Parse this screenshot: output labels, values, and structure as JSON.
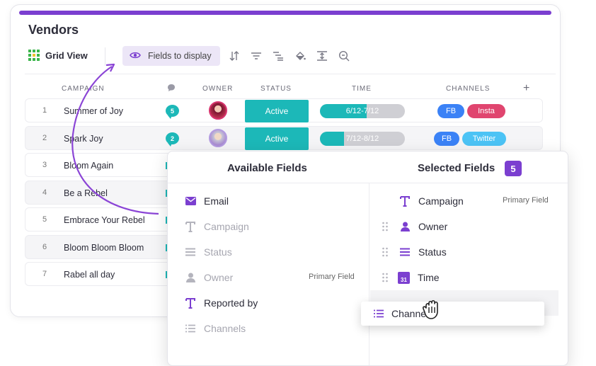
{
  "title": "Vendors",
  "toolbar": {
    "grid_view_label": "Grid View",
    "fields_to_display_label": "Fields to display",
    "icons": [
      "sort-icon",
      "filter-icon",
      "group-icon",
      "color-icon",
      "row-height-icon",
      "search-icon"
    ]
  },
  "table": {
    "headers": {
      "campaign": "CAMPAIGN",
      "owner": "OWNER",
      "status": "STATUS",
      "time": "TIME",
      "channels": "CHANNELS",
      "add": "+"
    },
    "rows": [
      {
        "num": "1",
        "name": "Summer of Joy",
        "comments": "5",
        "status": "Active",
        "time": "6/12-7/12",
        "time_progress": 0.55,
        "channels": [
          "FB",
          "Insta"
        ]
      },
      {
        "num": "2",
        "name": "Spark Joy",
        "comments": "2",
        "status": "Active",
        "time": "7/12-8/12",
        "time_progress": 0.28,
        "channels": [
          "FB",
          "Twitter"
        ]
      },
      {
        "num": "3",
        "name": "Bloom Again"
      },
      {
        "num": "4",
        "name": "Be a Rebel"
      },
      {
        "num": "5",
        "name": "Embrace Your Rebel"
      },
      {
        "num": "6",
        "name": "Bloom Bloom Bloom"
      },
      {
        "num": "7",
        "name": "Rabel all day"
      }
    ]
  },
  "popup": {
    "available_title": "Available Fields",
    "selected_title": "Selected Fields",
    "selected_count": "5",
    "available": [
      {
        "label": "Email",
        "icon": "email-icon",
        "enabled": true
      },
      {
        "label": "Campaign",
        "icon": "text-icon",
        "enabled": false
      },
      {
        "label": "Status",
        "icon": "status-icon",
        "enabled": false
      },
      {
        "label": "Owner",
        "icon": "person-icon",
        "enabled": false,
        "tag": "Primary Field"
      },
      {
        "label": "Reported by",
        "icon": "text-icon",
        "enabled": true
      },
      {
        "label": "Channels",
        "icon": "list-icon",
        "enabled": false
      }
    ],
    "selected": [
      {
        "label": "Campaign",
        "icon": "text-icon",
        "tag": "Primary Field"
      },
      {
        "label": "Owner",
        "icon": "person-icon"
      },
      {
        "label": "Status",
        "icon": "status-icon"
      },
      {
        "label": "Time",
        "icon": "calendar-icon",
        "icon_text": "31"
      }
    ],
    "dragging": {
      "label": "Channels",
      "icon": "list-icon"
    }
  },
  "colors": {
    "accent": "#7b3fd0",
    "teal": "#1cb8b8",
    "fb": "#3b82f6",
    "insta": "#e0456f",
    "twitter": "#4cc3f5"
  }
}
